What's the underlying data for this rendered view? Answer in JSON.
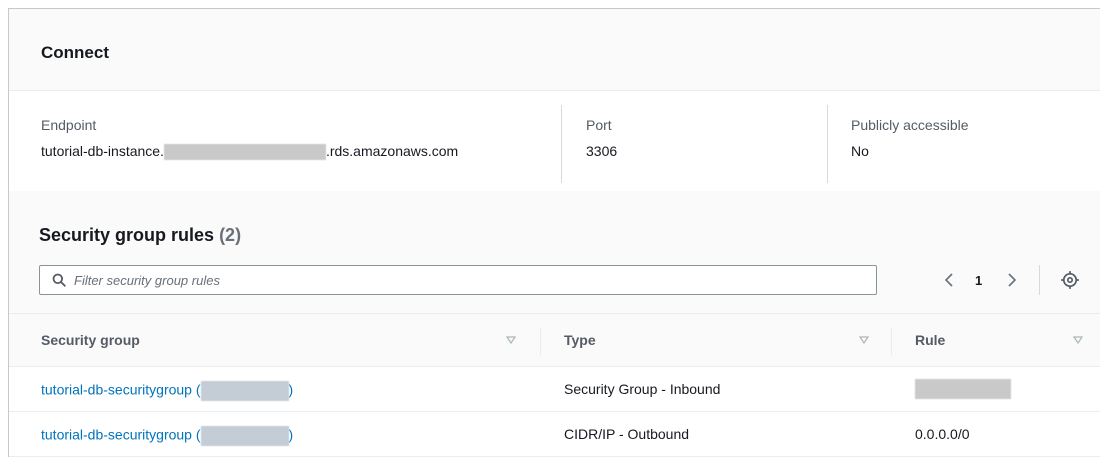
{
  "connect": {
    "title": "Connect",
    "endpoint": {
      "label": "Endpoint",
      "value_prefix": "tutorial-db-instance.",
      "value_suffix": ".rds.amazonaws.com"
    },
    "port": {
      "label": "Port",
      "value": "3306"
    },
    "public": {
      "label": "Publicly accessible",
      "value": "No"
    }
  },
  "security_group_rules": {
    "title": "Security group rules",
    "count": "(2)",
    "search_placeholder": "Filter security group rules",
    "pagination": {
      "current_page": "1"
    },
    "columns": [
      "Security group",
      "Type",
      "Rule"
    ],
    "rows": [
      {
        "group_name": "tutorial-db-securitygroup (",
        "group_close": ")",
        "type": "Security Group - Inbound",
        "rule": ""
      },
      {
        "group_name": "tutorial-db-securitygroup (",
        "group_close": ")",
        "type": "CIDR/IP - Outbound",
        "rule": "0.0.0.0/0"
      }
    ]
  },
  "colors": {
    "link": "#0073bb",
    "text_primary": "#16191f",
    "text_secondary": "#545b64",
    "redaction": "#c9c9c9"
  },
  "icons": [
    "search-icon",
    "chevron-left-icon",
    "chevron-right-icon",
    "settings-icon",
    "sort-icon"
  ]
}
